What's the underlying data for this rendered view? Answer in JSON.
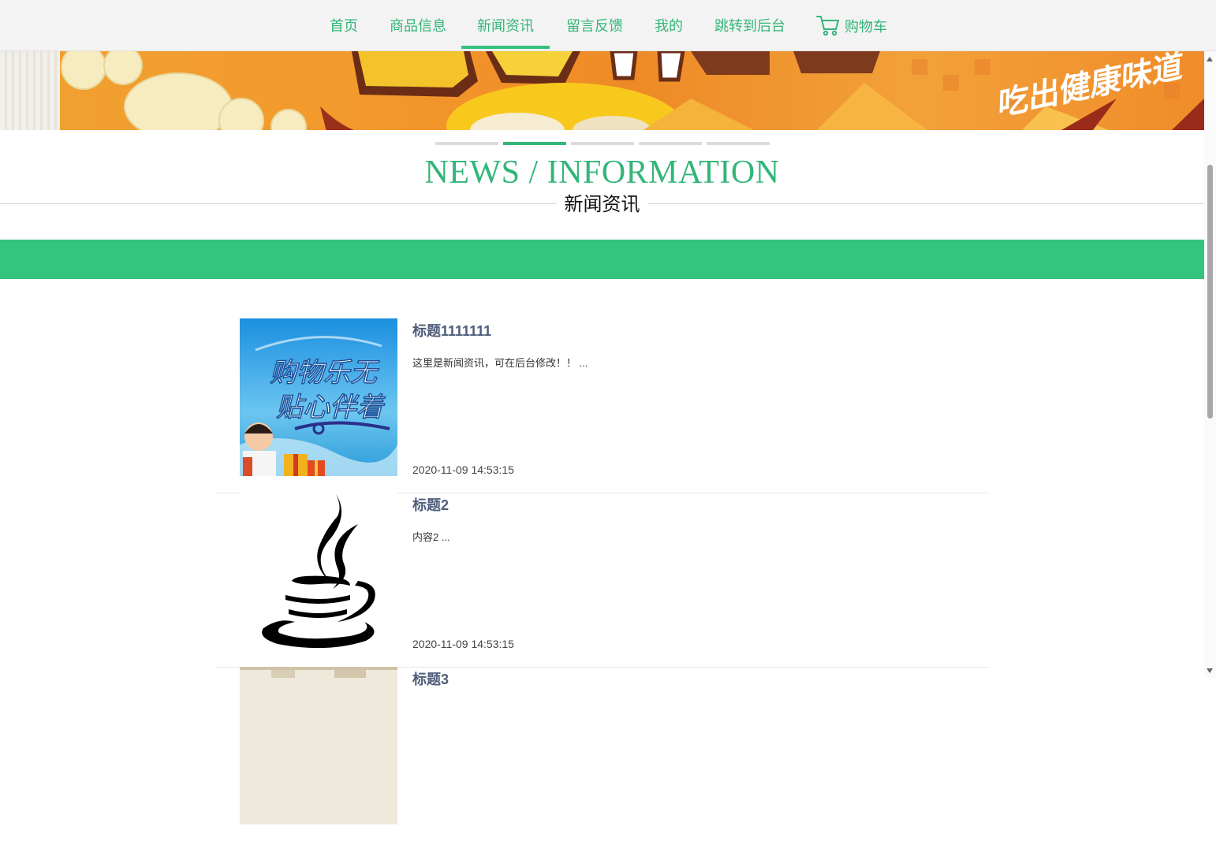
{
  "nav": {
    "items": [
      {
        "label": "首页"
      },
      {
        "label": "商品信息"
      },
      {
        "label": "新闻资讯"
      },
      {
        "label": "留言反馈"
      },
      {
        "label": "我的"
      },
      {
        "label": "跳转到后台"
      }
    ],
    "active_index": 2,
    "cart_label": "购物车"
  },
  "banner": {
    "slogan": "吃出健康味道",
    "slide_count": 5,
    "active_slide": 2
  },
  "section": {
    "title_en": "NEWS / INFORMATION",
    "title_cn": "新闻资讯"
  },
  "news": [
    {
      "title": "标题1111111",
      "summary": "这里是新闻资讯，可在后台修改！！ ...",
      "time": "2020-11-09 14:53:15",
      "image_text_1": "购物乐无",
      "image_text_2": "贴心伴着"
    },
    {
      "title": "标题2",
      "summary": "内容2 ...",
      "time": "2020-11-09 14:53:15"
    },
    {
      "title": "标题3"
    }
  ],
  "colors": {
    "brand_green": "#33b679",
    "bar_green": "#33c47e",
    "title_blue": "#4e5d7a",
    "nav_bg": "#f3f3f3"
  }
}
